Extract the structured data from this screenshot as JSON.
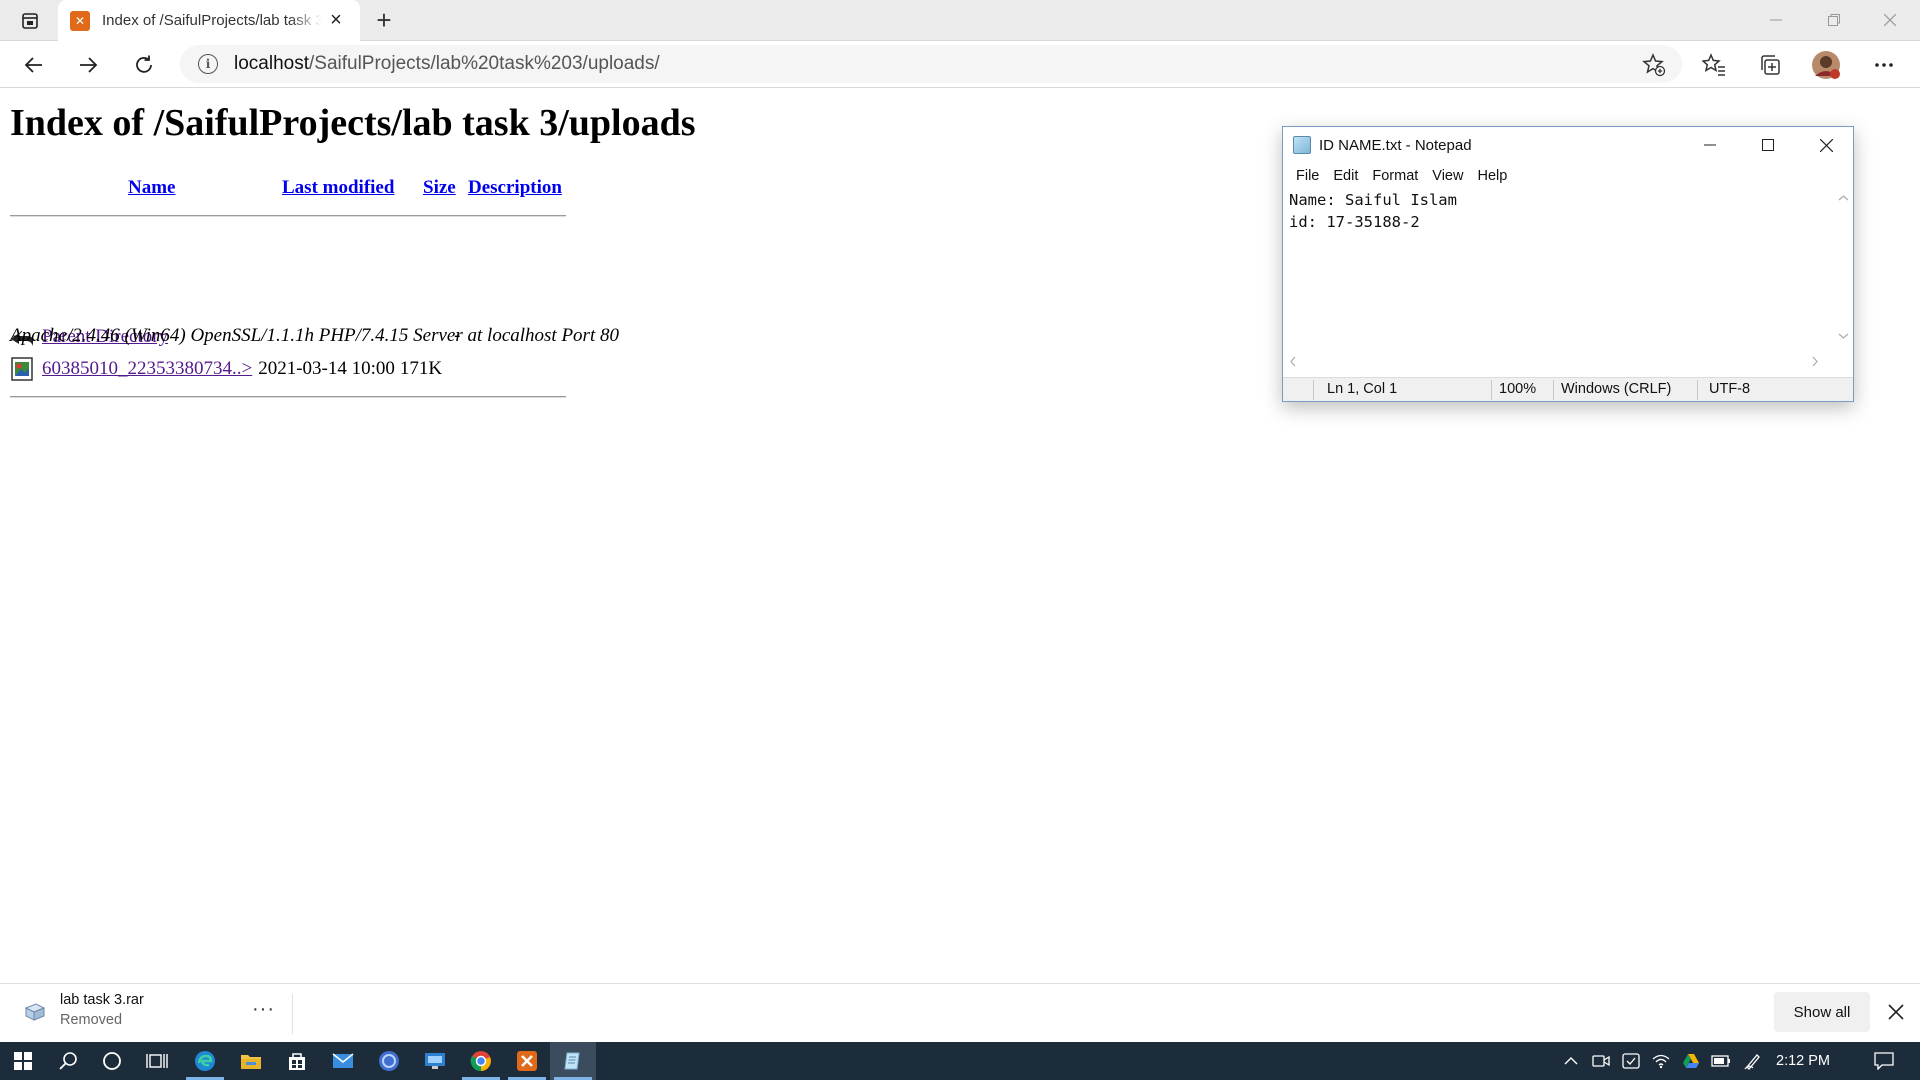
{
  "browser": {
    "tab": {
      "title": "Index of /SaifulProjects/lab task 3/uploads/"
    },
    "address": {
      "host": "localhost",
      "path": "/SaifulProjects/lab%20task%203/uploads/"
    }
  },
  "page": {
    "heading": "Index of /SaifulProjects/lab task 3/uploads",
    "columns": {
      "name": "Name",
      "last_modified": "Last modified",
      "size": "Size",
      "description": "Description"
    },
    "rows": [
      {
        "icon": "back-icon",
        "name": "Parent Directory",
        "last_modified": "",
        "size": "-",
        "description": ""
      },
      {
        "icon": "image-file-icon",
        "name": "60385010_22353380734..>",
        "last_modified": "2021-03-14 10:00",
        "size": "171K",
        "description": ""
      }
    ],
    "server_signature": "Apache/2.4.46 (Win64) OpenSSL/1.1.1h PHP/7.4.15 Server at localhost Port 80"
  },
  "notepad": {
    "title": "ID NAME.txt - Notepad",
    "menu": [
      "File",
      "Edit",
      "Format",
      "View",
      "Help"
    ],
    "content": "Name: Saiful Islam\nid: 17-35188-2",
    "status": {
      "position": "Ln 1, Col 1",
      "zoom": "100%",
      "line_ending": "Windows (CRLF)",
      "encoding": "UTF-8"
    }
  },
  "downloads": {
    "item": {
      "name": "lab task 3.rar",
      "status": "Removed"
    },
    "show_all": "Show all"
  },
  "taskbar": {
    "time": "2:12 PM"
  },
  "colors": {
    "link": "#0000ee",
    "visited_link": "#551a8b",
    "taskbar": "#1d2c3b",
    "xampp_orange": "#e06a1a"
  }
}
